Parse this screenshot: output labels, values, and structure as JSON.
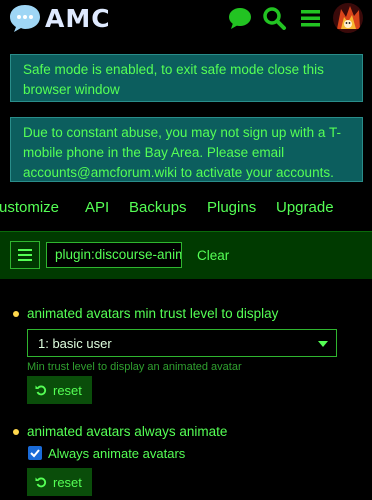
{
  "header": {
    "logo_text": "AMC",
    "icons": [
      "chat-bubble-icon",
      "search-icon",
      "hamburger-menu-icon"
    ],
    "avatar": "user-avatar"
  },
  "alerts": {
    "safe_mode": "Safe mode is enabled, to exit safe mode close this browser window",
    "notice": "Due to constant abuse, you may not sign up with a T-mobile phone in the Bay Area. Please email accounts@amcforum.wiki to activate your accounts."
  },
  "tabs": [
    "ustomize",
    "API",
    "Backups",
    "Plugins",
    "Upgrade"
  ],
  "filter": {
    "value": "plugin:discourse-anim",
    "clear_label": "Clear"
  },
  "settings": [
    {
      "label": "animated avatars min trust level to display",
      "select_value": "1: basic user",
      "description": "Min trust level to display an animated avatar",
      "reset_label": "reset"
    },
    {
      "label": "animated avatars always animate",
      "checkbox_label": "Always animate avatars",
      "checked": true,
      "reset_label": "reset"
    }
  ],
  "colors": {
    "background": "#000000",
    "text_green": "#55ff55",
    "alert_bg": "#0c5e5e",
    "filter_bar_bg": "#003a00",
    "button_bg": "#0a4d0a",
    "checkbox_blue": "#1a6bd8",
    "bullet_yellow": "#ffd84d"
  }
}
